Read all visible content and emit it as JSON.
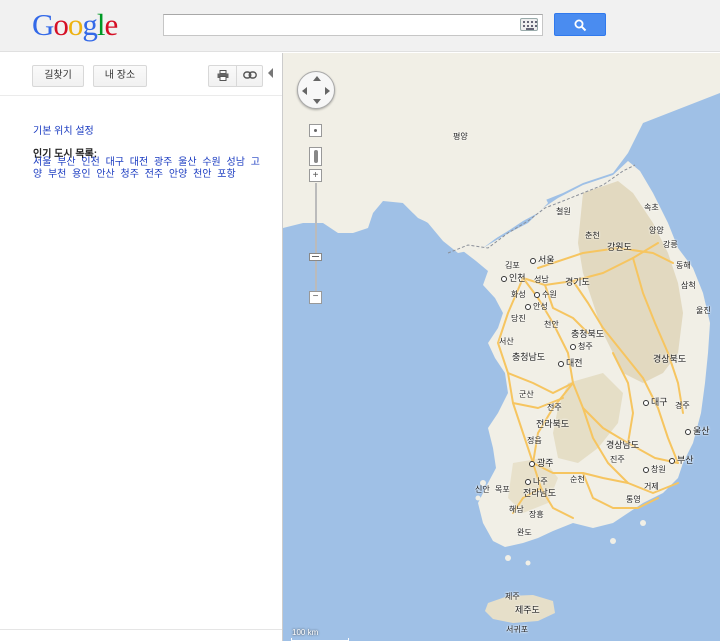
{
  "header": {
    "logo_letters": [
      {
        "ch": "G",
        "color": "#3369e8"
      },
      {
        "ch": "o",
        "color": "#d50f25"
      },
      {
        "ch": "o",
        "color": "#eeb211"
      },
      {
        "ch": "g",
        "color": "#3369e8"
      },
      {
        "ch": "l",
        "color": "#009925"
      },
      {
        "ch": "e",
        "color": "#d50f25"
      }
    ],
    "search_value": "",
    "keyboard_icon": "keyboard-icon",
    "search_icon": "magnifier-icon",
    "accent_color": "#4a8cf0"
  },
  "panel": {
    "toolbar": {
      "directions_label": "길찾기",
      "my_places_label": "내 장소",
      "print_icon": "printer-icon",
      "link_icon": "link-icon"
    },
    "set_default_location": "기본 위치 설정",
    "popular_cities_title": "인기 도시 목록:",
    "popular_cities": [
      "서울",
      "부산",
      "인천",
      "대구",
      "대전",
      "광주",
      "울산",
      "수원",
      "성남",
      "고양",
      "부천",
      "용인",
      "안산",
      "청주",
      "전주",
      "안양",
      "천안",
      "포항"
    ],
    "footer_link": "",
    "link_color": "#1a3bc1"
  },
  "map": {
    "labels": {
      "pyongyang": "평양",
      "cheorwon": "철원",
      "sokcho": "속초",
      "yangyang": "양양",
      "chuncheon": "춘천",
      "gangwon": "강원도",
      "gangneung": "강릉",
      "gimpo": "김포",
      "seoul": "서울",
      "incheon": "인천",
      "seongnam": "성남",
      "gyeonggi": "경기도",
      "donghae": "동해",
      "samcheok": "삼척",
      "hwaseong": "화성",
      "suwon": "수원",
      "anseong": "안성",
      "uljin": "울진",
      "dangjin": "당진",
      "cheonan": "천안",
      "chungbuk": "충청북도",
      "seosan": "서산",
      "cheongju": "청주",
      "chungnam": "충청남도",
      "daejeon": "대전",
      "gyeongbuk": "경상북도",
      "gunsan": "군산",
      "jeonju": "전주",
      "daegu": "대구",
      "gyeongju": "경주",
      "jeonbuk": "전라북도",
      "ulsan": "울산",
      "jeongeup": "정읍",
      "gyeongnam": "경상남도",
      "jinju": "진주",
      "busan": "부산",
      "gwangju": "광주",
      "changwon": "창원",
      "naju": "나주",
      "mokpo": "목포",
      "sinan": "신안",
      "suncheon": "순천",
      "geoje": "거제",
      "jeonnam": "전라남도",
      "tongyeong": "통영",
      "haenam": "해남",
      "jangheung": "장흥",
      "wando": "완도",
      "jeju_city": "제주",
      "jeju_do": "제주도",
      "seogwipo": "서귀포"
    },
    "controls": {
      "pan_icon": "pan-arrows-icon",
      "zoom_in": "+",
      "zoom_out": "−",
      "streetview_icon": "pegman-icon"
    },
    "scale_label": "100 km",
    "colors": {
      "sea": "#9fc0e6",
      "land": "#f1efe6",
      "mountain": "#dfd5b8",
      "highway": "#f6c560",
      "border": "#8a8f99"
    }
  }
}
